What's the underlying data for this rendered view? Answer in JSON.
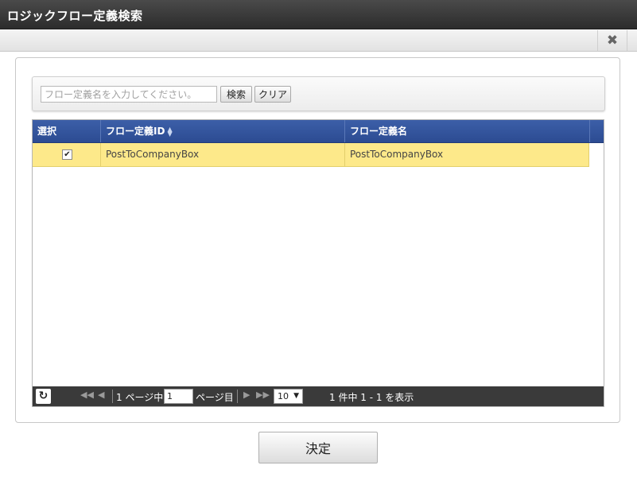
{
  "window": {
    "title": "ロジックフロー定義検索"
  },
  "toolbar": {
    "close_glyph": "✖"
  },
  "search": {
    "placeholder": "フロー定義名を入力してください。",
    "search_label": "検索",
    "clear_label": "クリア"
  },
  "grid": {
    "columns": [
      "選択",
      "フロー定義ID",
      "フロー定義名"
    ],
    "sort_icon": "sort-icon",
    "rows": [
      {
        "selected": true,
        "id": "PostToCompanyBox",
        "name": "PostToCompanyBox"
      }
    ]
  },
  "pager": {
    "page_prefix": "1 ページ中",
    "page_value": "1",
    "page_suffix": "ページ目",
    "page_size": "10",
    "summary": "1 件中 1 - 1 を表示"
  },
  "footer": {
    "decide_label": "決定"
  },
  "colors": {
    "header_blue": "#2c4b92",
    "row_selected": "#fde98a",
    "titlebar": "#2c2c2c"
  }
}
